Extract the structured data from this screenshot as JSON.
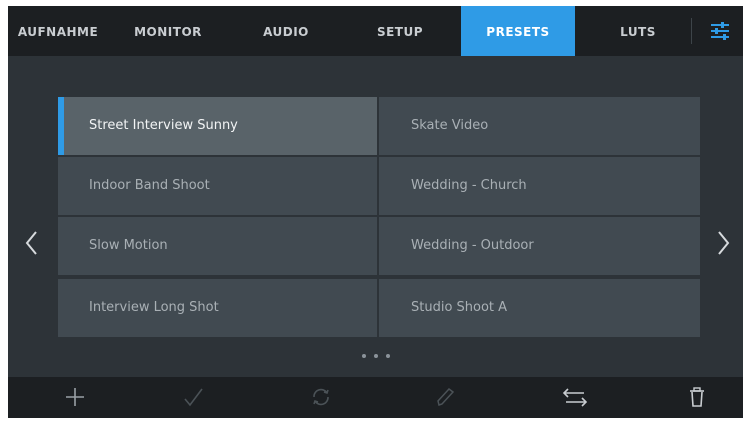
{
  "tabs": [
    {
      "label": "AUFNAHME",
      "active": false
    },
    {
      "label": "MONITOR",
      "active": false
    },
    {
      "label": "AUDIO",
      "active": false
    },
    {
      "label": "SETUP",
      "active": false
    },
    {
      "label": "PRESETS",
      "active": true
    },
    {
      "label": "LUTS",
      "active": false
    }
  ],
  "presets": [
    {
      "name": "Street Interview Sunny",
      "selected": true
    },
    {
      "name": "Skate Video",
      "selected": false
    },
    {
      "name": "Indoor Band Shoot",
      "selected": false
    },
    {
      "name": "Wedding  - Church",
      "selected": false
    },
    {
      "name": "Slow Motion",
      "selected": false
    },
    {
      "name": "Wedding - Outdoor",
      "selected": false
    },
    {
      "name": "Interview Long Shot",
      "selected": false
    },
    {
      "name": "Studio Shoot A",
      "selected": false
    }
  ],
  "pagination": {
    "pages": 3,
    "current": 1
  },
  "toolbar": {
    "add_icon": "plus-icon",
    "apply_icon": "checkmark-icon",
    "update_icon": "refresh-icon",
    "rename_icon": "pencil-icon",
    "import_export_icon": "transfer-arrows-icon",
    "delete_icon": "trash-icon"
  },
  "colors": {
    "accent": "#2f9be6",
    "background": "#2d3338",
    "bar": "#1c1f22",
    "cell": "#414a51",
    "cell_selected": "#596369"
  }
}
